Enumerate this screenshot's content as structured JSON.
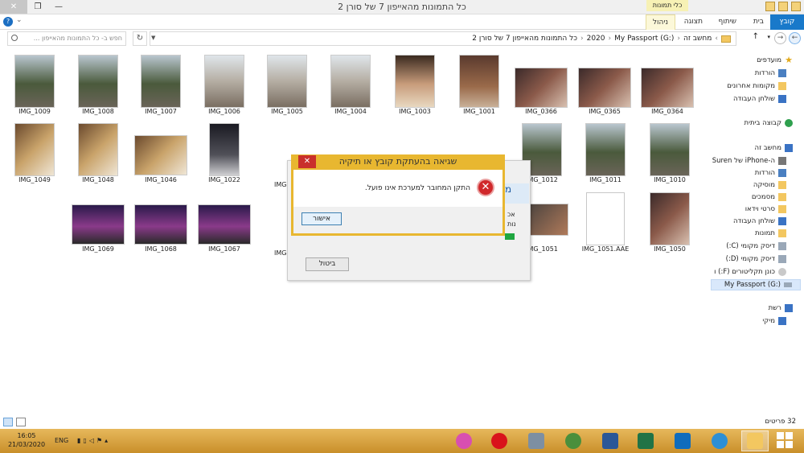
{
  "window": {
    "title": "כל התמונות מהאייפון 7 של סורן 2",
    "context_tab": "כלי תמונות",
    "close_glyph": "✕",
    "max_glyph": "❐",
    "min_glyph": "—"
  },
  "ribbon": {
    "tabs": [
      "קובץ",
      "בית",
      "שיתוף",
      "תצוגה",
      "ניהול"
    ],
    "help_glyph": "?"
  },
  "address": {
    "crumbs": [
      "מחשב זה",
      "My Passport (G:)",
      "2020",
      "כל התמונות מהאייפון 7 של סורן 2"
    ],
    "search_placeholder": "חפש ב- כל התמונות מהאייפון ..."
  },
  "nav": {
    "favorites": "מועדפים",
    "downloads": "הורדות",
    "recent": "מקומות אחרונים",
    "desktop": "שולחן העבודה",
    "homegroup": "קבוצה ביתית",
    "this_pc": "מחשב זה",
    "iphone": "ה-iPhone של Suren",
    "downloads2": "הורדות",
    "music": "מוסיקה",
    "documents": "מסמכים",
    "videos": "סרטי וידאו",
    "desktop2": "שולחן העבודה",
    "pictures": "תמונות",
    "local_c": "דיסק מקומי (C:)",
    "local_d": "דיסק מקומי (D:)",
    "cd_drive": "כונן תקליטורים (F:) ו",
    "passport": "My Passport (G:)",
    "network": "רשת",
    "miki": "מיקי"
  },
  "files": [
    {
      "name": "IMG_0364",
      "kind": "party"
    },
    {
      "name": "IMG_0365",
      "kind": "party"
    },
    {
      "name": "IMG_0366",
      "kind": "party"
    },
    {
      "name": "IMG_1001",
      "kind": "street"
    },
    {
      "name": "IMG_1003",
      "kind": "portrait"
    },
    {
      "name": "IMG_1004",
      "kind": "cathedral"
    },
    {
      "name": "IMG_1005",
      "kind": "cathedral"
    },
    {
      "name": "IMG_1006",
      "kind": "cathedral"
    },
    {
      "name": "IMG_1007",
      "kind": "tree"
    },
    {
      "name": "IMG_1008",
      "kind": "tree"
    },
    {
      "name": "IMG_1009",
      "kind": "tree"
    },
    {
      "name": "IMG_1010",
      "kind": "tree"
    },
    {
      "name": "IMG_1011",
      "kind": "tree"
    },
    {
      "name": "IMG_1012",
      "kind": "tree"
    },
    {
      "name": "IMG_1022",
      "kind": "night"
    },
    {
      "name": "IMG_1046",
      "kind": "food"
    },
    {
      "name": "IMG_1048",
      "kind": "food"
    },
    {
      "name": "IMG_1049",
      "kind": "food"
    },
    {
      "name": "IMG_1050",
      "kind": "party"
    },
    {
      "name": "IMG_1051.AAE",
      "kind": "doc"
    },
    {
      "name": "IMG_1051",
      "kind": "video"
    },
    {
      "name": "IMG_1067",
      "kind": "stage"
    },
    {
      "name": "IMG_1068",
      "kind": "stage"
    },
    {
      "name": "IMG_1069",
      "kind": "stage"
    }
  ],
  "partial_label": "IMG",
  "dialog_error": {
    "title": "שגיאה בהעתקת קובץ או תיקיה",
    "message": "התקן המחובר למערכת אינו פועל.",
    "ok": "אישור",
    "close_glyph": "✕",
    "icon_glyph": "✕"
  },
  "dialog_progress": {
    "header": "מ",
    "line1": "אכ",
    "line2": "נות",
    "cancel": "ביטול"
  },
  "status": {
    "count": "32 פריטים"
  },
  "taskbar": {
    "time": "16:05",
    "date": "21/03/2020",
    "lang": "ENG",
    "apps": [
      {
        "name": "itunes",
        "color": "#d84fb0"
      },
      {
        "name": "opera",
        "color": "#d9131b"
      },
      {
        "name": "calculator",
        "color": "#7d8fa2"
      },
      {
        "name": "chrome",
        "color": "#4a8f3c"
      },
      {
        "name": "word",
        "color": "#2b5797"
      },
      {
        "name": "excel",
        "color": "#217346"
      },
      {
        "name": "outlook",
        "color": "#0f6cbd"
      },
      {
        "name": "internet-explorer",
        "color": "#2d8fd5"
      },
      {
        "name": "file-explorer",
        "color": "#f3c760"
      }
    ]
  }
}
